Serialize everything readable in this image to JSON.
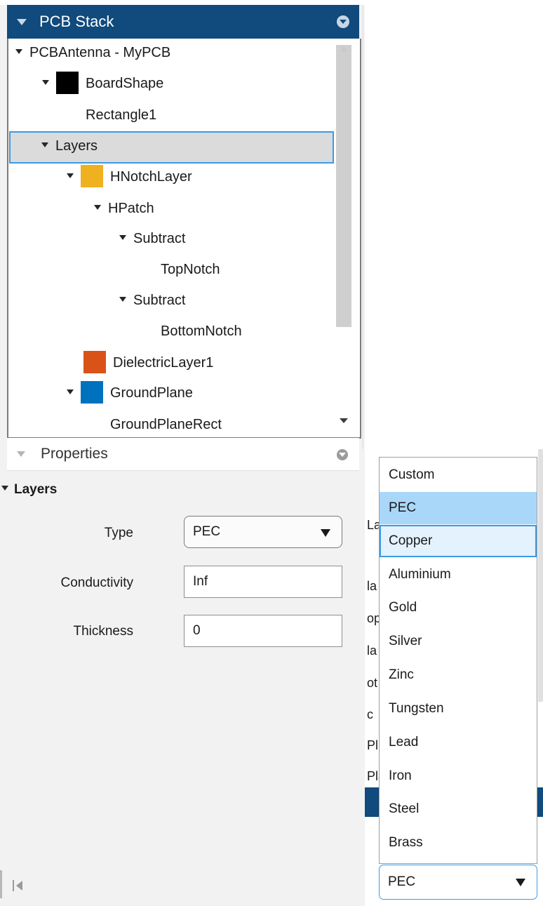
{
  "pcb_stack": {
    "title": "PCB Stack",
    "tree": [
      {
        "label": "PCBAntenna - MyPCB",
        "caret": true
      },
      {
        "label": "BoardShape",
        "caret": true,
        "swatch": "#000000"
      },
      {
        "label": "Rectangle1",
        "caret": false
      },
      {
        "label": "Layers",
        "caret": true,
        "selected": true
      },
      {
        "label": "HNotchLayer",
        "caret": true,
        "swatch": "#f0b120"
      },
      {
        "label": "HPatch",
        "caret": true
      },
      {
        "label": "Subtract",
        "caret": true
      },
      {
        "label": "TopNotch",
        "caret": false
      },
      {
        "label": "Subtract",
        "caret": true
      },
      {
        "label": "BottomNotch",
        "caret": false
      },
      {
        "label": "DielectricLayer1",
        "caret": false,
        "swatch": "#d95319"
      },
      {
        "label": "GroundPlane",
        "caret": true,
        "swatch": "#0072bd"
      },
      {
        "label": "GroundPlaneRect",
        "caret": false
      }
    ]
  },
  "properties": {
    "title": "Properties",
    "section": "Layers",
    "type_label": "Type",
    "type_value": "PEC",
    "conductivity_label": "Conductivity",
    "conductivity_value": "Inf",
    "thickness_label": "Thickness",
    "thickness_value": "0"
  },
  "background_fragments": [
    "La",
    "la",
    "op",
    "la",
    "ot",
    "c",
    "Pl",
    "Pla"
  ],
  "dropdown": {
    "options": [
      "Custom",
      "PEC",
      "Copper",
      "Aluminium",
      "Gold",
      "Silver",
      "Zinc",
      "Tungsten",
      "Lead",
      "Iron",
      "Steel",
      "Brass"
    ],
    "selected": "PEC",
    "hovered": "Copper",
    "field_value": "PEC"
  },
  "colors": {
    "header": "#114a7c",
    "selection_border": "#3d9ae2",
    "selected_option": "#a9d7fa"
  }
}
